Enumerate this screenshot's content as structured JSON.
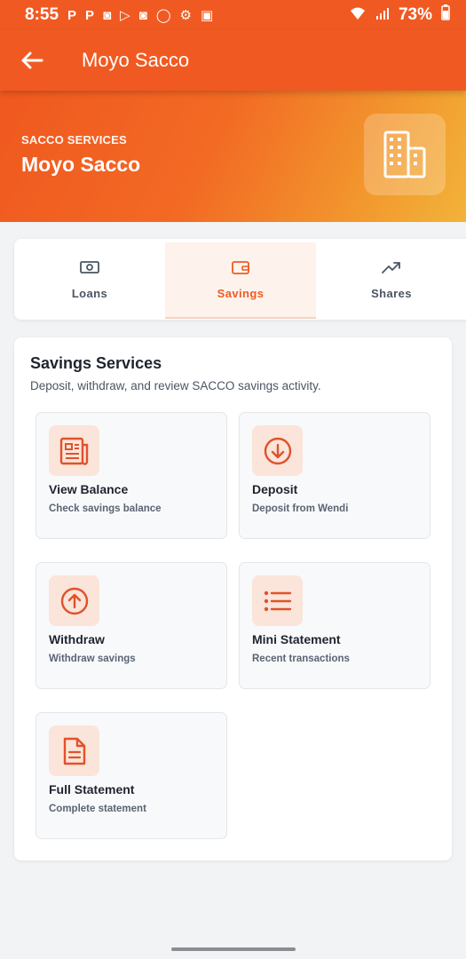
{
  "status_bar": {
    "time": "8:55",
    "battery": "73%"
  },
  "app_bar": {
    "title": "Moyo Sacco"
  },
  "hero": {
    "subtitle": "SACCO SERVICES",
    "title": "Moyo Sacco"
  },
  "tabs": [
    {
      "label": "Loans",
      "icon": "cash-icon",
      "active": false
    },
    {
      "label": "Savings",
      "icon": "wallet-icon",
      "active": true
    },
    {
      "label": "Shares",
      "icon": "trending-up-icon",
      "active": false
    }
  ],
  "section": {
    "title": "Savings Services",
    "description": "Deposit, withdraw, and review SACCO savings activity."
  },
  "services": [
    {
      "title": "View Balance",
      "subtitle": "Check savings balance",
      "icon": "newspaper-icon"
    },
    {
      "title": "Deposit",
      "subtitle": "Deposit from Wendi",
      "icon": "arrow-down-circle-icon"
    },
    {
      "title": "Withdraw",
      "subtitle": "Withdraw savings",
      "icon": "arrow-up-circle-icon"
    },
    {
      "title": "Mini Statement",
      "subtitle": "Recent transactions",
      "icon": "list-icon"
    },
    {
      "title": "Full Statement",
      "subtitle": "Complete statement",
      "icon": "document-icon"
    }
  ],
  "colors": {
    "primary": "#f05a22",
    "accent_light": "#fbe4da",
    "active_tab_bg": "#fdf3ec"
  }
}
